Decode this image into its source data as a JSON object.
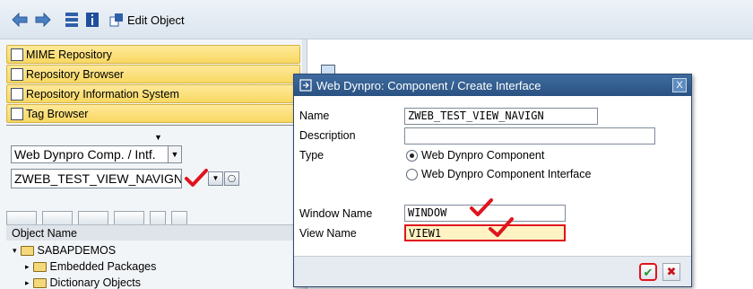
{
  "toolbar": {
    "back_icon": "back-arrow-icon",
    "forward_icon": "forward-arrow-icon",
    "edit_object_label": "Edit Object"
  },
  "left_nav": {
    "items": [
      {
        "label": "MIME Repository",
        "icon": "mime-icon"
      },
      {
        "label": "Repository Browser",
        "icon": "hierarchy-icon"
      },
      {
        "label": "Repository Information System",
        "icon": "info-system-icon"
      },
      {
        "label": "Tag Browser",
        "icon": "tag-icon"
      }
    ]
  },
  "object_selector": {
    "type_value": "Web Dynpro Comp. / Intf.",
    "name_value": "ZWEB_TEST_VIEW_NAVIGN"
  },
  "tree": {
    "header": "Object Name",
    "rows": [
      {
        "label": "SABAPDEMOS",
        "indent": 0
      },
      {
        "label": "Embedded Packages",
        "indent": 1
      },
      {
        "label": "Dictionary Objects",
        "indent": 1
      }
    ]
  },
  "dialog": {
    "title": "Web Dynpro: Component / Create Interface",
    "close_label": "X",
    "fields": {
      "name_label": "Name",
      "name_value": "ZWEB_TEST_VIEW_NAVIGN",
      "description_label": "Description",
      "description_value": "",
      "type_label": "Type",
      "type_options": [
        "Web Dynpro Component",
        "Web Dynpro Component Interface"
      ],
      "type_selected": "Web Dynpro Component",
      "window_label": "Window Name",
      "window_value": "WINDOW",
      "view_label": "View Name",
      "view_value": "VIEW1"
    },
    "confirm_symbol": "✔",
    "cancel_symbol": "✖"
  },
  "colors": {
    "accent_yellow": "#f8d862",
    "dialog_title": "#2a5282",
    "annotation_red": "#e0141e"
  }
}
